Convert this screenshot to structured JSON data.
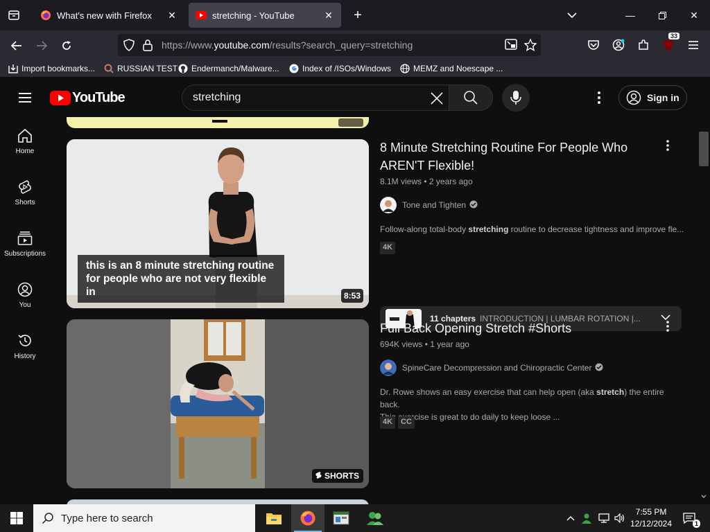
{
  "browser": {
    "tabs": [
      {
        "title": "What's new with Firefox",
        "active": false
      },
      {
        "title": "stretching - YouTube",
        "active": true
      }
    ],
    "url_prefix": "https://www.",
    "url_domain": "youtube.com",
    "url_path": "/results?search_query=stretching",
    "extensions_badge": "33",
    "bookmarks": [
      {
        "label": "Import bookmarks...",
        "icon": "import-icon"
      },
      {
        "label": "RUSSIAN TEST",
        "icon": "magnifier-icon"
      },
      {
        "label": "Endermanch/Malware...",
        "icon": "github-icon"
      },
      {
        "label": "Index of /ISOs/Windows",
        "icon": "google-icon"
      },
      {
        "label": "MEMZ and Noescape ...",
        "icon": "globe-icon"
      }
    ]
  },
  "youtube": {
    "logo_text": "YouTube",
    "search_value": "stretching",
    "signin_label": "Sign in",
    "sidebar": [
      {
        "label": "Home",
        "icon": "home-icon"
      },
      {
        "label": "Shorts",
        "icon": "shorts-icon"
      },
      {
        "label": "Subscriptions",
        "icon": "subscriptions-icon"
      },
      {
        "label": "You",
        "icon": "you-icon"
      },
      {
        "label": "History",
        "icon": "history-icon"
      }
    ],
    "results": [
      {
        "title_line1": "8 Minute Stretching Routine For People Who",
        "title_line2": "AREN'T Flexible!",
        "views": "8.1M views",
        "age": "2 years ago",
        "channel": "Tone and Tighten",
        "verified": true,
        "desc_before": "Follow-along total-body ",
        "desc_bold": "stretching",
        "desc_after": " routine to decrease tightness and improve fle...",
        "tags": [
          "4K"
        ],
        "duration": "8:53",
        "caption_line1": "this is an 8 minute stretching routine",
        "caption_line2": "for people who are not very flexible in",
        "chapters_count": "11 chapters",
        "chapters_text": "INTRODUCTION | LUMBAR ROTATION |..."
      },
      {
        "title_line1": "Full Back Opening Stretch #Shorts",
        "views": "694K views",
        "age": "1 year ago",
        "channel": "SpineCare Decompression and Chiropractic Center",
        "verified": true,
        "desc_line1_before": "Dr. Rowe shows an easy exercise that can help open (aka ",
        "desc_line1_bold": "stretch",
        "desc_line1_after": ") the entire back.",
        "desc_line2": "This exercise is great to do daily to keep loose ...",
        "tags": [
          "4K",
          "CC"
        ],
        "badge": "SHORTS"
      }
    ]
  },
  "taskbar": {
    "search_placeholder": "Type here to search",
    "time": "7:55 PM",
    "date": "12/12/2024",
    "notification_count": "1"
  }
}
